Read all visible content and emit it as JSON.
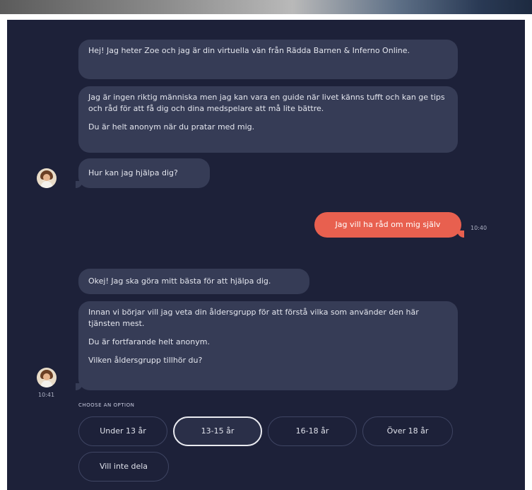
{
  "chat": {
    "bot_messages_1": [
      [
        "Hej! Jag heter Zoe och jag är din virtuella vän från Rädda Barnen & Inferno Online."
      ],
      [
        "Jag är ingen riktig människa men jag kan vara en guide när livet känns tufft och kan ge tips och råd för att få dig och dina medspelare att må lite bättre.",
        "Du är helt anonym när du pratar med mig."
      ],
      [
        "Hur kan jag hjälpa dig?"
      ]
    ],
    "user_message": {
      "text": "Jag vill ha råd om mig själv",
      "time": "10:40"
    },
    "bot_messages_2": [
      [
        "Okej! Jag ska göra mitt bästa för att hjälpa dig."
      ],
      [
        "Innan vi börjar vill jag veta din åldersgrupp för att förstå vilka som använder den här tjänsten mest.",
        "Du är fortfarande helt anonym.",
        "Vilken åldersgrupp tillhör du?"
      ]
    ],
    "bot_time_2": "10:41"
  },
  "options": {
    "label": "CHOOSE AN OPTION",
    "items": [
      "Under 13 år",
      "13-15 år",
      "16-18 år",
      "Över 18 år",
      "Vill inte dela"
    ],
    "selected": "13-15 år"
  },
  "colors": {
    "background": "#1d2139",
    "bot_bubble": "#363c56",
    "user_bubble": "#e8604f",
    "option_border": "#3f4563"
  },
  "icons": {
    "avatar": "bot-avatar-icon"
  }
}
